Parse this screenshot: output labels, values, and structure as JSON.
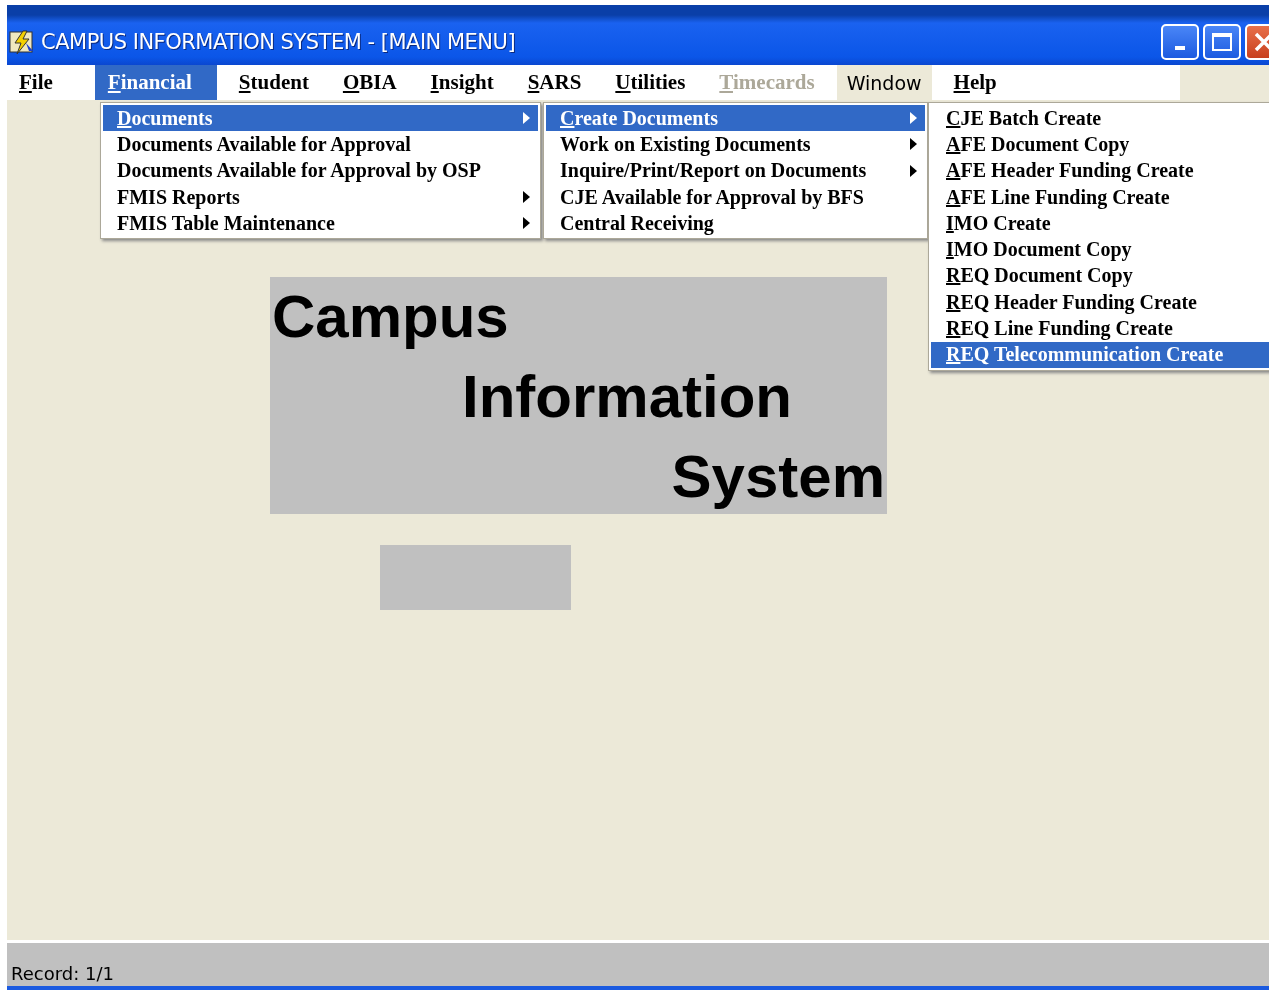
{
  "window": {
    "title": "CAMPUS INFORMATION SYSTEM - [MAIN MENU]"
  },
  "menu_bar": [
    {
      "label": "File",
      "kind": "menu",
      "selected": false,
      "disabled": false,
      "mnemonic": true
    },
    {
      "label": "Financial",
      "kind": "menu",
      "selected": true,
      "disabled": false,
      "mnemonic": true
    },
    {
      "label": "Student",
      "kind": "menu",
      "selected": false,
      "disabled": false,
      "mnemonic": true
    },
    {
      "label": "OBIA",
      "kind": "menu",
      "selected": false,
      "disabled": false,
      "mnemonic": true
    },
    {
      "label": "Insight",
      "kind": "menu",
      "selected": false,
      "disabled": false,
      "mnemonic": true
    },
    {
      "label": "SARS",
      "kind": "menu",
      "selected": false,
      "disabled": false,
      "mnemonic": true
    },
    {
      "label": "Utilities",
      "kind": "menu",
      "selected": false,
      "disabled": false,
      "mnemonic": true
    },
    {
      "label": "Timecards",
      "kind": "menu",
      "selected": false,
      "disabled": true,
      "mnemonic": true
    },
    {
      "label": "Window",
      "kind": "system",
      "selected": false,
      "disabled": false,
      "mnemonic": false
    },
    {
      "label": "Help",
      "kind": "menu",
      "selected": false,
      "disabled": false,
      "mnemonic": true
    }
  ],
  "menus": [
    {
      "items": [
        {
          "label": "Documents",
          "selected": true,
          "submenu": true,
          "mnemonic": true
        },
        {
          "label": "Documents Available for Approval",
          "selected": false,
          "submenu": false,
          "mnemonic": false
        },
        {
          "label": "Documents Available for Approval by OSP",
          "selected": false,
          "submenu": false,
          "mnemonic": false
        },
        {
          "label": "FMIS Reports",
          "selected": false,
          "submenu": true,
          "mnemonic": false
        },
        {
          "label": "FMIS Table Maintenance",
          "selected": false,
          "submenu": true,
          "mnemonic": false
        }
      ]
    },
    {
      "items": [
        {
          "label": "Create Documents",
          "selected": true,
          "submenu": true,
          "mnemonic": true
        },
        {
          "label": "Work on Existing Documents",
          "selected": false,
          "submenu": true,
          "mnemonic": false
        },
        {
          "label": "Inquire/Print/Report on Documents",
          "selected": false,
          "submenu": true,
          "mnemonic": false
        },
        {
          "label": "CJE Available for Approval by BFS",
          "selected": false,
          "submenu": false,
          "mnemonic": false
        },
        {
          "label": "Central Receiving",
          "selected": false,
          "submenu": false,
          "mnemonic": false
        }
      ]
    },
    {
      "items": [
        {
          "label": "CJE Batch Create",
          "selected": false,
          "mnemonic": true
        },
        {
          "label": "AFE Document Copy",
          "selected": false,
          "mnemonic": true
        },
        {
          "label": "AFE Header Funding Create",
          "selected": false,
          "mnemonic": true
        },
        {
          "label": "AFE Line Funding Create",
          "selected": false,
          "mnemonic": true
        },
        {
          "label": "IMO Create",
          "selected": false,
          "mnemonic": true
        },
        {
          "label": "IMO Document Copy",
          "selected": false,
          "mnemonic": true
        },
        {
          "label": "REQ Document Copy",
          "selected": false,
          "mnemonic": true
        },
        {
          "label": "REQ Header Funding Create",
          "selected": false,
          "mnemonic": true
        },
        {
          "label": "REQ Line Funding Create",
          "selected": false,
          "mnemonic": true
        },
        {
          "label": "REQ Telecommunication Create",
          "selected": true,
          "mnemonic": true
        }
      ]
    }
  ],
  "logo": [
    "Campus",
    "Information",
    "System"
  ],
  "status_bar": {
    "text": "Record: 1/1"
  }
}
